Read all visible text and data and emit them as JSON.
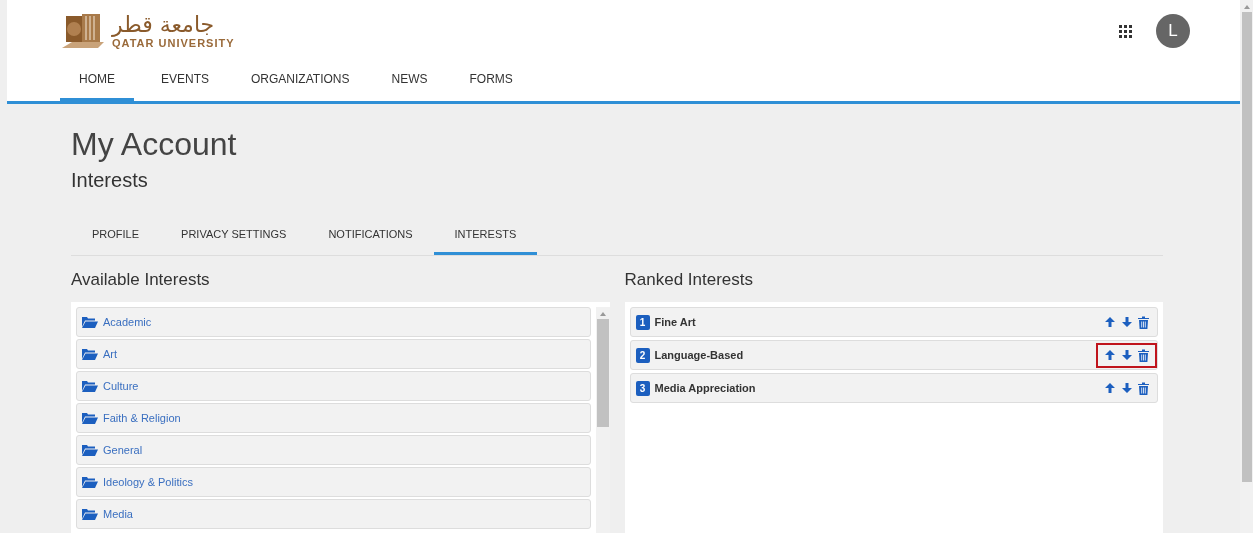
{
  "logo": {
    "arabic": "جامعة قطر",
    "english": "QATAR UNIVERSITY"
  },
  "nav": [
    {
      "label": "HOME",
      "selected": true
    },
    {
      "label": "EVENTS",
      "selected": false
    },
    {
      "label": "ORGANIZATIONS",
      "selected": false
    },
    {
      "label": "NEWS",
      "selected": false
    },
    {
      "label": "FORMS",
      "selected": false
    }
  ],
  "user": {
    "initial": "L"
  },
  "page": {
    "title": "My Account",
    "subtitle": "Interests"
  },
  "tabs": [
    {
      "label": "PROFILE",
      "selected": false
    },
    {
      "label": "PRIVACY SETTINGS",
      "selected": false
    },
    {
      "label": "NOTIFICATIONS",
      "selected": false
    },
    {
      "label": "INTERESTS",
      "selected": true
    }
  ],
  "available": {
    "heading": "Available Interests",
    "items": [
      "Academic",
      "Art",
      "Culture",
      "Faith & Religion",
      "General",
      "Ideology & Politics",
      "Media"
    ]
  },
  "ranked": {
    "heading": "Ranked Interests",
    "items": [
      {
        "rank": "1",
        "name": "Fine Art",
        "highlighted": false
      },
      {
        "rank": "2",
        "name": "Language-Based",
        "highlighted": true
      },
      {
        "rank": "3",
        "name": "Media Appreciation",
        "highlighted": false
      }
    ]
  }
}
